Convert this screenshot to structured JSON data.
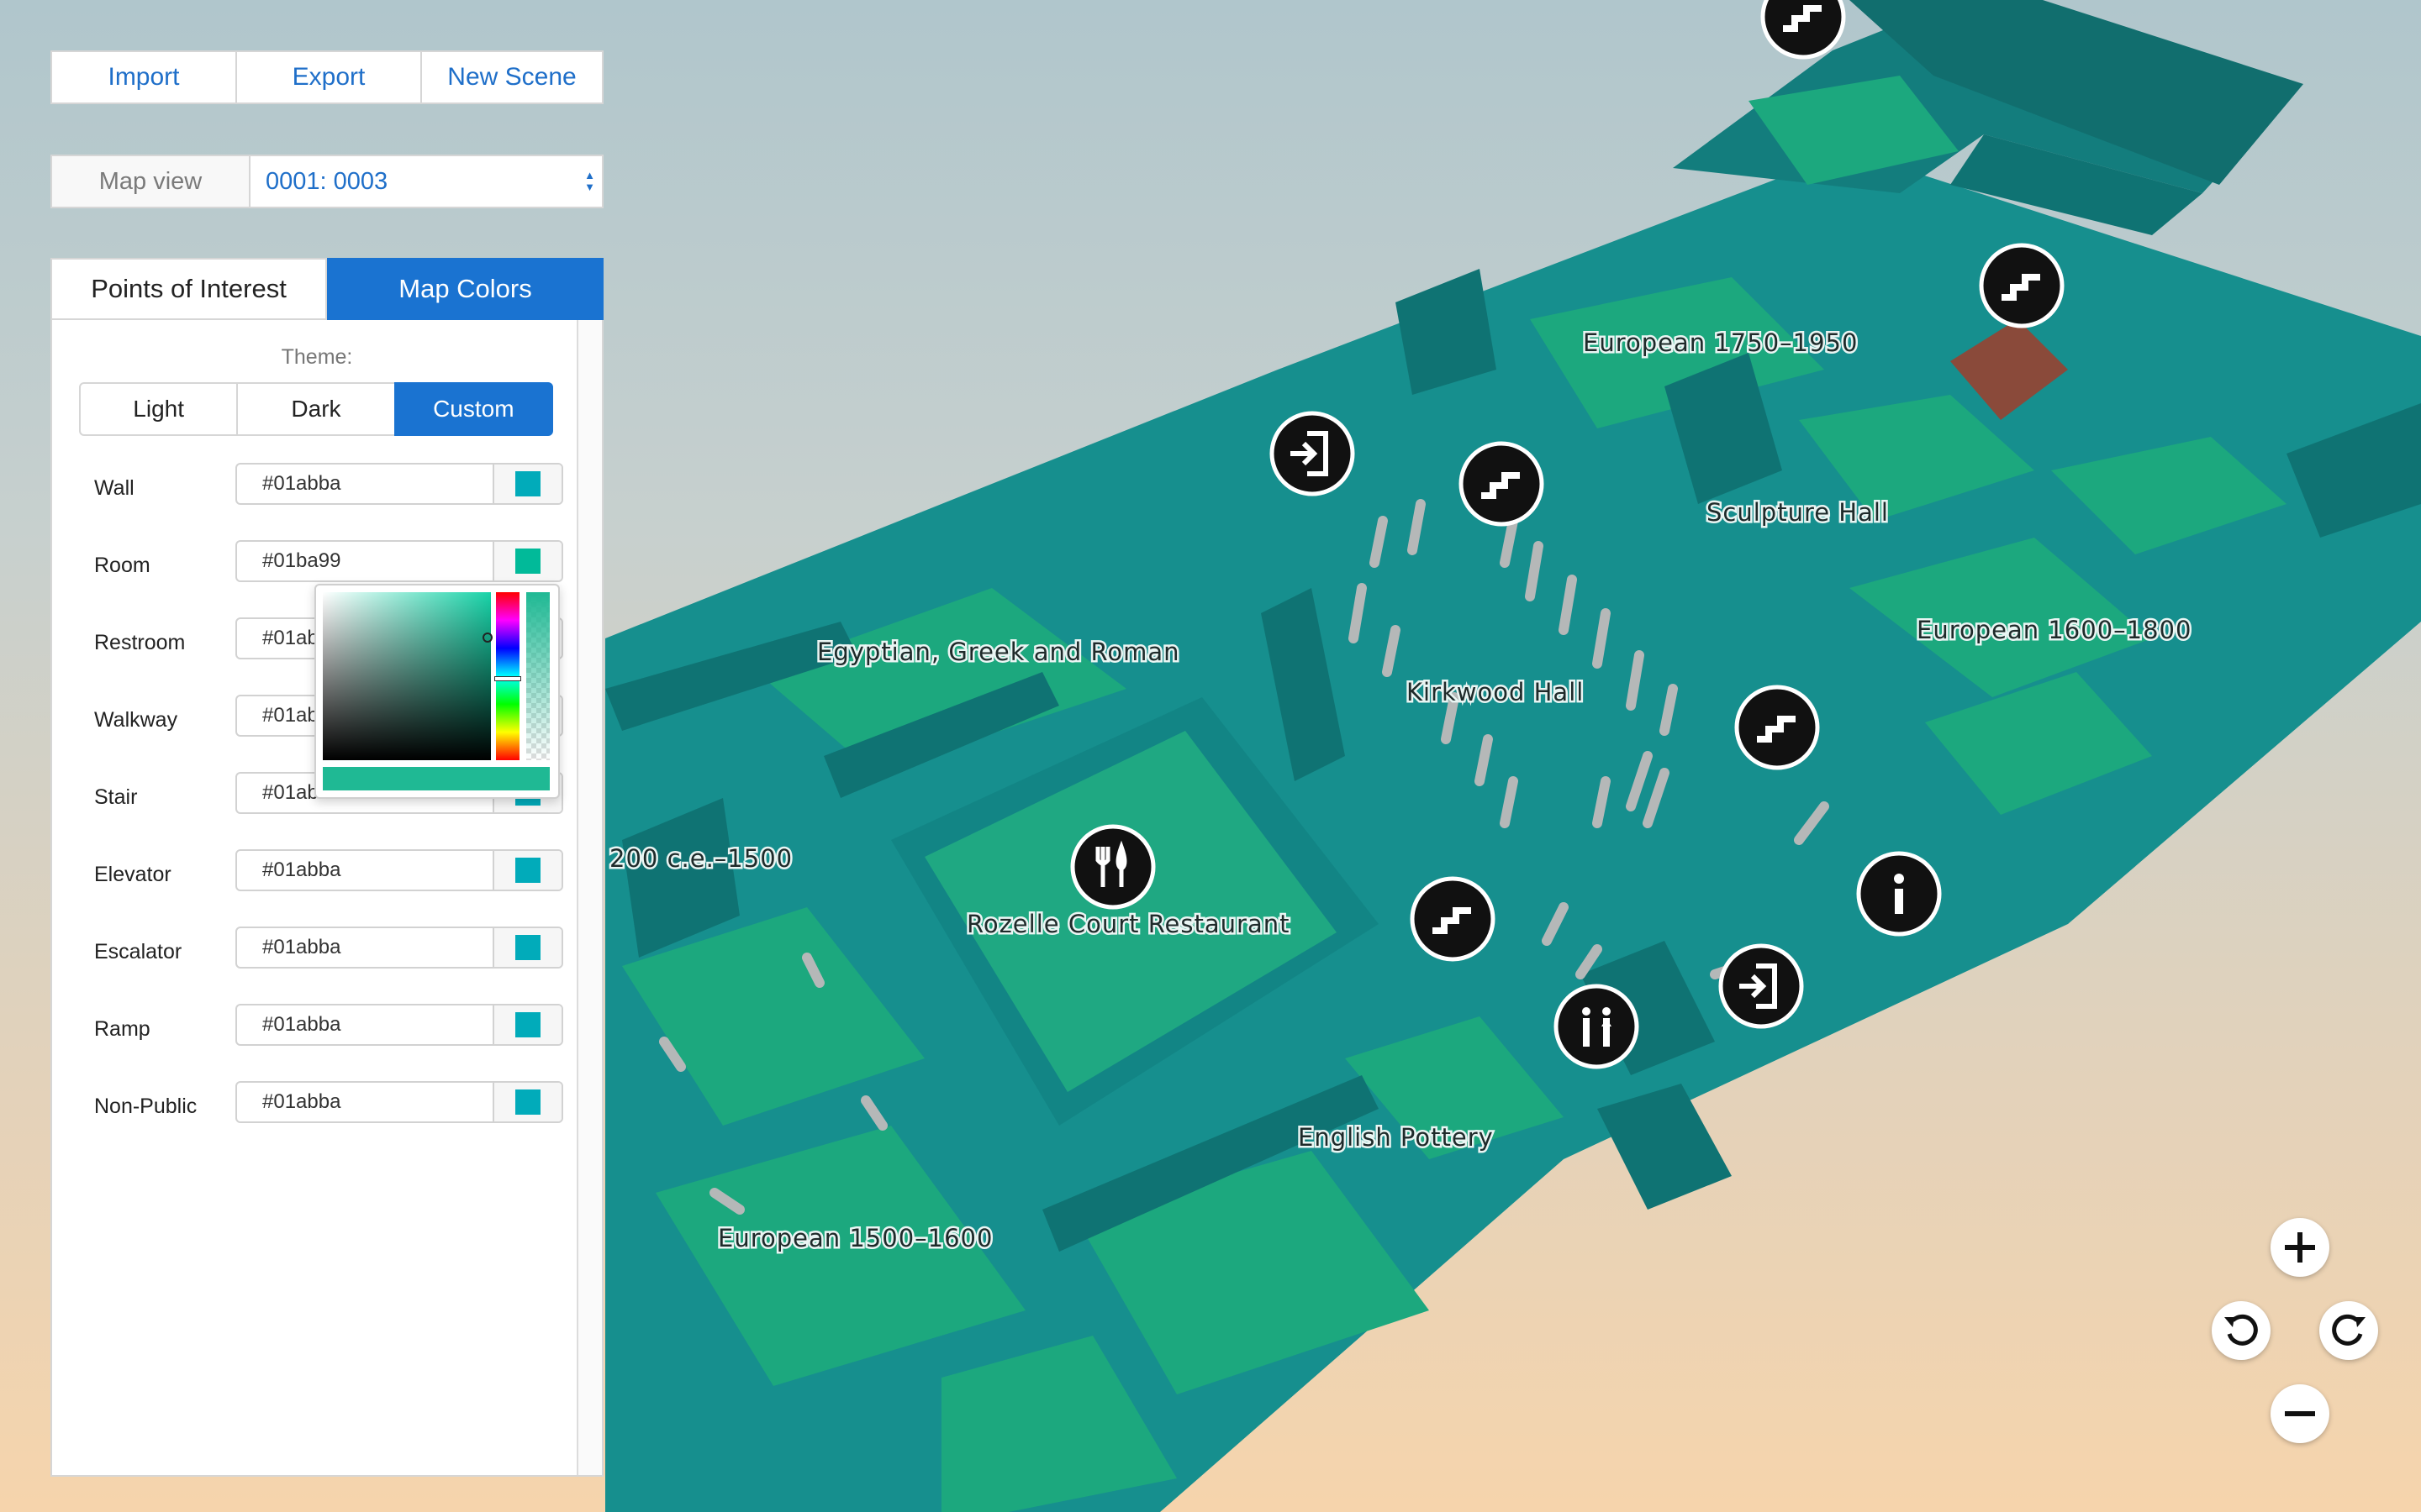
{
  "toolbar": {
    "import_label": "Import",
    "export_label": "Export",
    "new_scene_label": "New Scene"
  },
  "map_view": {
    "label": "Map view",
    "selected": "0001: 0003"
  },
  "tabs": [
    {
      "label": "Points of Interest",
      "active": false
    },
    {
      "label": "Map Colors",
      "active": true
    }
  ],
  "theme": {
    "label": "Theme:",
    "options": [
      "Light",
      "Dark",
      "Custom"
    ],
    "selected": "Custom"
  },
  "colors": [
    {
      "name": "Wall",
      "value": "#01abba"
    },
    {
      "name": "Room",
      "value": "#01ba99"
    },
    {
      "name": "Restroom",
      "value": "#01abba"
    },
    {
      "name": "Walkway",
      "value": "#01abba"
    },
    {
      "name": "Stair",
      "value": "#01abba"
    },
    {
      "name": "Elevator",
      "value": "#01abba"
    },
    {
      "name": "Escalator",
      "value": "#01abba"
    },
    {
      "name": "Ramp",
      "value": "#01abba"
    },
    {
      "name": "Non-Public",
      "value": "#01abba"
    }
  ],
  "map_labels": {
    "european_1750": "European 1750–1950",
    "sculpture_hall": "Sculpture Hall",
    "european_1600": "European 1600–1800",
    "egyptian": "Egyptian, Greek and Roman",
    "kirkwood": "Kirkwood Hall",
    "medieval": "200 c.e.–1500",
    "rozelle": "Rozelle Court Restaurant",
    "english_pottery": "English Pottery",
    "european_1500": "European 1500–1600"
  },
  "map_icons": [
    "stairs-icon",
    "stairs-icon",
    "exit-icon",
    "stairs-icon",
    "stairs-icon",
    "restaurant-icon",
    "stairs-icon",
    "information-icon",
    "exit-icon",
    "restroom-icon"
  ],
  "map_controls": [
    "zoom-in-icon",
    "rotate-left-icon",
    "rotate-right-icon",
    "zoom-out-icon"
  ],
  "palette": {
    "wall": "#1a9b9b",
    "wall_dark": "#147f80",
    "room": "#1ca87e",
    "accent": "#1a73d1",
    "picker_color": "#1fb994"
  }
}
